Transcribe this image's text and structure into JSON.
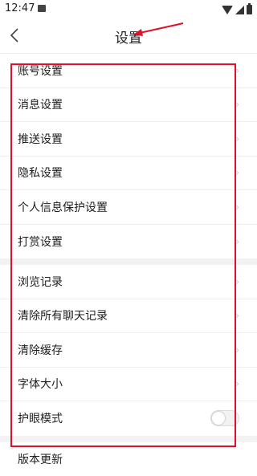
{
  "status_bar": {
    "time": "12:47"
  },
  "header": {
    "title": "设置",
    "back_icon": "chevron-left-icon"
  },
  "section1": [
    {
      "label": "账号设置",
      "icon": "chevron-right-icon"
    },
    {
      "label": "消息设置",
      "icon": "chevron-right-icon"
    },
    {
      "label": "推送设置",
      "icon": "chevron-right-icon"
    },
    {
      "label": "隐私设置",
      "icon": "chevron-right-icon"
    },
    {
      "label": "个人信息保护设置",
      "icon": "chevron-right-icon"
    },
    {
      "label": "打赏设置",
      "icon": "chevron-right-icon"
    }
  ],
  "section2": [
    {
      "label": "浏览记录",
      "icon": "chevron-right-icon"
    },
    {
      "label": "清除所有聊天记录",
      "icon": "chevron-right-icon"
    },
    {
      "label": "清除缓存",
      "icon": "chevron-right-icon"
    },
    {
      "label": "字体大小",
      "icon": "chevron-right-icon"
    },
    {
      "label": "护眼模式",
      "toggle": false
    }
  ],
  "section3": [
    {
      "label": "版本更新"
    }
  ],
  "colors": {
    "annotation_red": "#e0102a",
    "background": "#ffffff",
    "section_gap": "#f2f2f2"
  }
}
